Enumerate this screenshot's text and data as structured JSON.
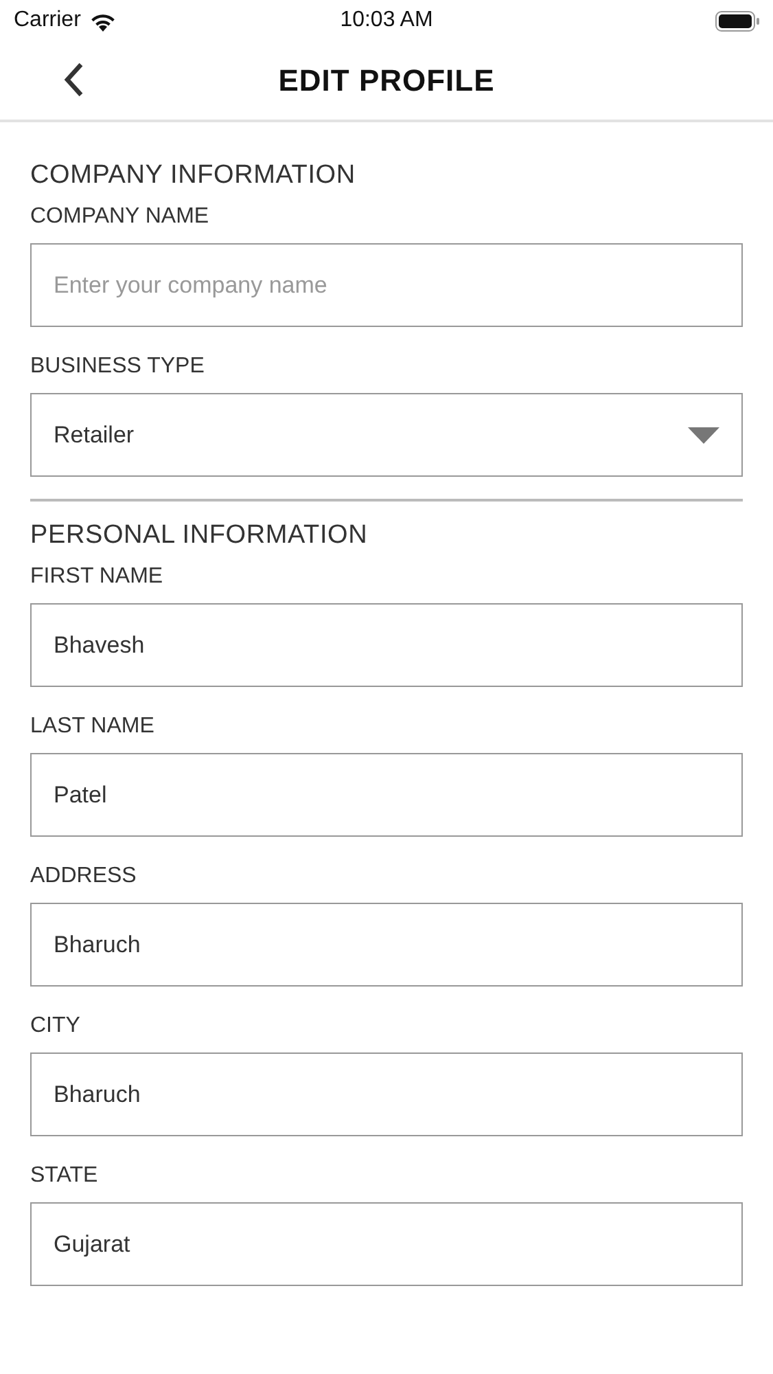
{
  "status_bar": {
    "carrier": "Carrier",
    "time": "10:03 AM"
  },
  "nav": {
    "title": "EDIT PROFILE"
  },
  "sections": [
    {
      "title": "COMPANY INFORMATION",
      "fields": [
        {
          "kind": "text",
          "label": "COMPANY NAME",
          "placeholder": "Enter your company name"
        },
        {
          "kind": "dropdown",
          "label": "BUSINESS TYPE",
          "value": "Retailer"
        }
      ]
    },
    {
      "title": "PERSONAL INFORMATION",
      "fields": [
        {
          "kind": "text",
          "label": "FIRST NAME",
          "value": "Bhavesh"
        },
        {
          "kind": "text",
          "label": "LAST NAME",
          "value": "Patel"
        },
        {
          "kind": "text",
          "label": "ADDRESS",
          "value": "Bharuch"
        },
        {
          "kind": "text",
          "label": "CITY",
          "value": "Bharuch"
        },
        {
          "kind": "text",
          "label": "STATE",
          "value": "Gujarat"
        }
      ]
    }
  ]
}
